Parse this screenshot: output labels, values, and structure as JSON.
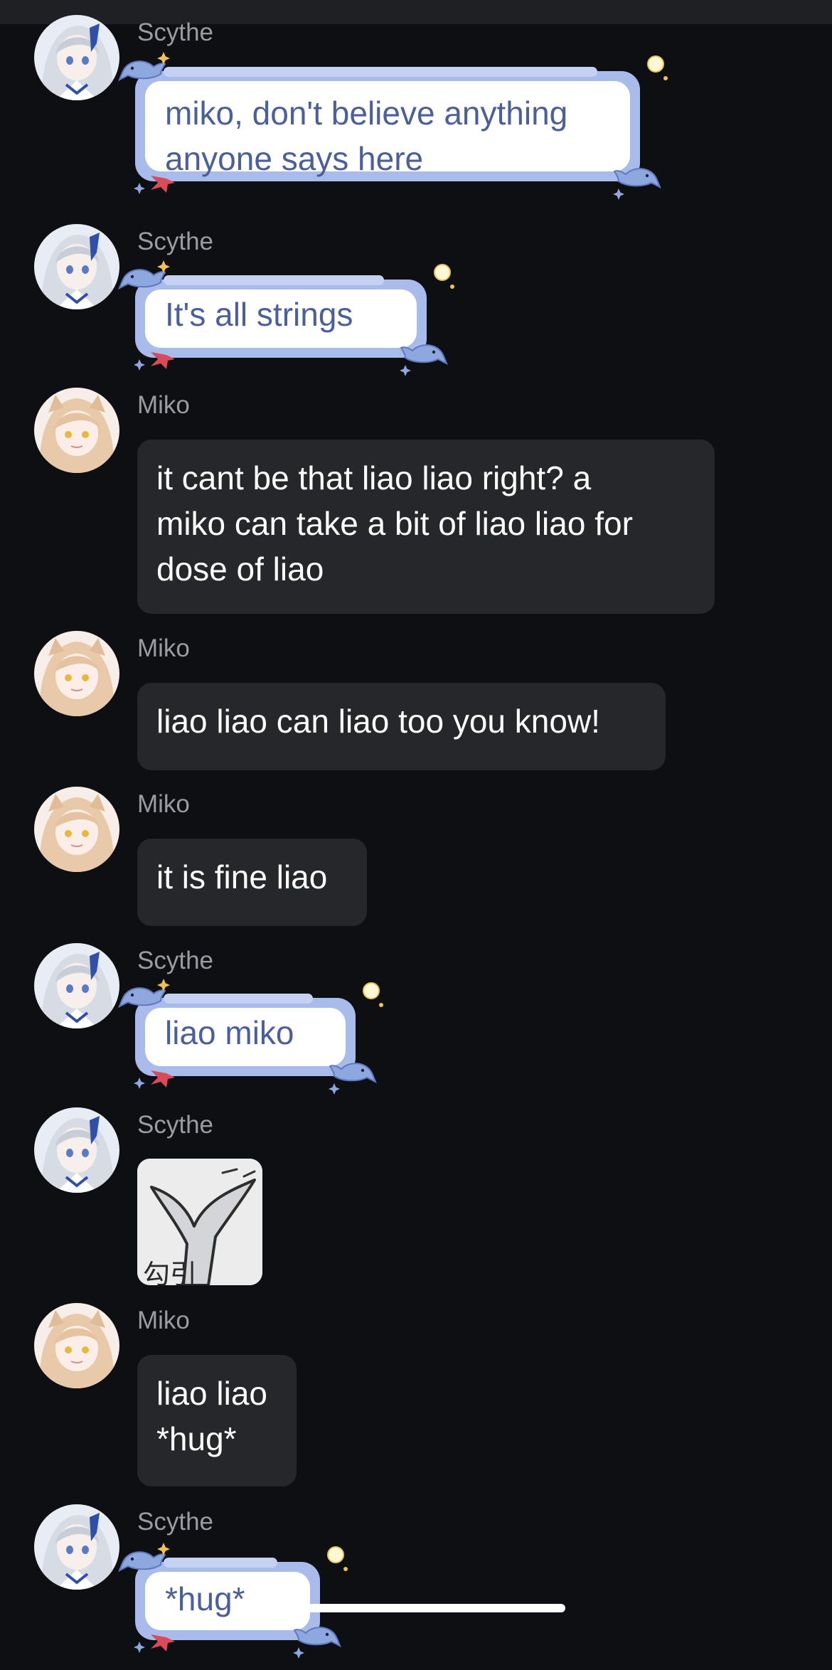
{
  "colors": {
    "background": "#0e0f12",
    "bubble": "#26272b",
    "username": "#9a9ca3",
    "deco_text": "#4b5f9a",
    "deco_outline": "#a9bbeb"
  },
  "messages": [
    {
      "user": "Scythe",
      "text": "miko, don't believe anything\nanyone says here"
    },
    {
      "user": "Scythe",
      "text": "It's all strings"
    },
    {
      "user": "Miko",
      "text": "it cant be that liao liao right? a\nmiko can take a bit of liao liao for\ndose of liao"
    },
    {
      "user": "Miko",
      "text": "liao liao can liao too you know!"
    },
    {
      "user": "Miko",
      "text": "it is fine liao"
    },
    {
      "user": "Scythe",
      "text": "liao miko"
    },
    {
      "user": "Scythe",
      "sticker_icon": "whale-tail-sticker",
      "sticker_text": "勾引"
    },
    {
      "user": "Miko",
      "text": "liao liao\n*hug*"
    },
    {
      "user": "Scythe",
      "text": "*hug*"
    }
  ]
}
